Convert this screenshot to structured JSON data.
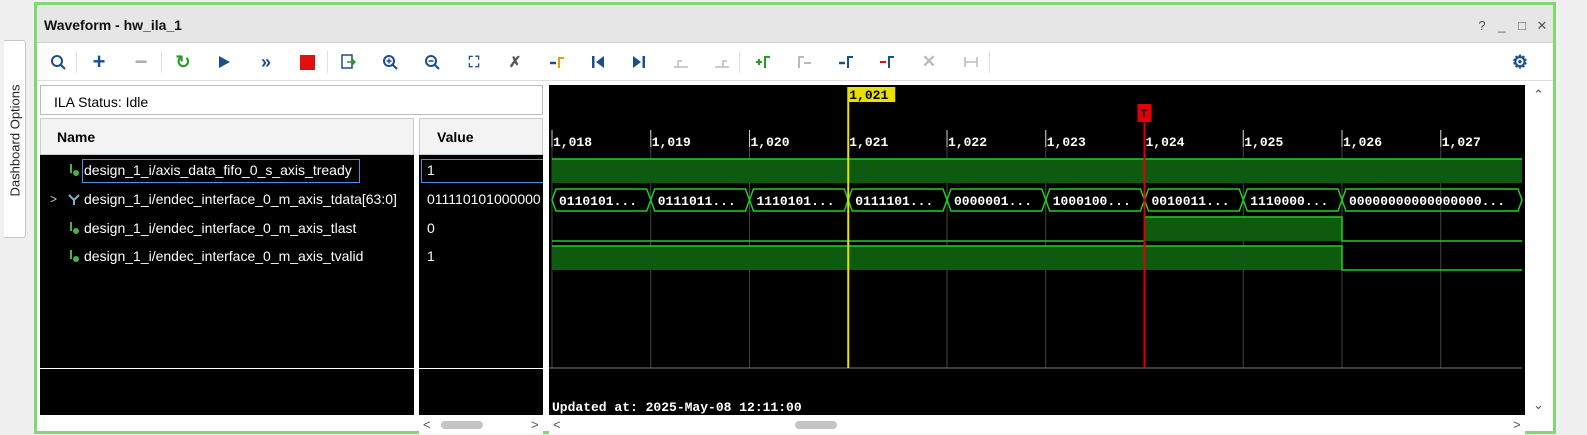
{
  "sidebar": {
    "label": "Dashboard Options"
  },
  "window": {
    "title": "Waveform - hw_ila_1",
    "controls": [
      "?",
      "_",
      "□",
      "✕"
    ]
  },
  "toolbar": {
    "icons": [
      "search-icon",
      "add-icon",
      "remove-icon",
      "refresh-icon",
      "run-icon",
      "run-all-icon",
      "stop-icon",
      "export-icon",
      "zoom-in-icon",
      "zoom-out-icon",
      "zoom-fit-icon",
      "cursor-delete-icon",
      "goto-cursor-icon",
      "goto-first-icon",
      "goto-last-icon",
      "prev-transition-icon",
      "next-transition-icon",
      "add-marker-icon",
      "prev-marker-icon",
      "next-marker-icon",
      "remove-marker-icon",
      "delete-icon",
      "swap-icon",
      "settings-icon"
    ]
  },
  "status": {
    "text": "ILA Status: Idle"
  },
  "columns": {
    "name": "Name",
    "value": "Value"
  },
  "signals": [
    {
      "name": "design_1_i/axis_data_fifo_0_s_axis_tready",
      "value": "1",
      "bus": false
    },
    {
      "name": "design_1_i/endec_interface_0_m_axis_tdata[63:0]",
      "value": "011110101000000",
      "bus": true
    },
    {
      "name": "design_1_i/endec_interface_0_m_axis_tlast",
      "value": "0",
      "bus": false
    },
    {
      "name": "design_1_i/endec_interface_0_m_axis_tvalid",
      "value": "1",
      "bus": false
    }
  ],
  "waveform": {
    "cursor_label": "1,021",
    "trigger_label": "T",
    "ticks": [
      "1,018",
      "1,019",
      "1,020",
      "1,021",
      "1,022",
      "1,023",
      "1,024",
      "1,025",
      "1,026",
      "1,027"
    ],
    "bus_values": [
      "0110101...",
      "0111011...",
      "1110101...",
      "0111101...",
      "0000001...",
      "1000100...",
      "0010011...",
      "1110000...",
      "00000000000000000..."
    ],
    "bus_value_segments": [
      1,
      1,
      1,
      1,
      1,
      1,
      1,
      1,
      2
    ],
    "tready": [
      1,
      1,
      1,
      1,
      1,
      1,
      1,
      1,
      1,
      1
    ],
    "tlast": [
      0,
      0,
      0,
      0,
      0,
      0,
      1,
      1,
      0,
      0
    ],
    "tvalid": [
      1,
      1,
      1,
      1,
      1,
      1,
      1,
      1,
      0,
      0
    ],
    "updated": "Updated at: 2025-May-08 12:11:00"
  },
  "colors": {
    "wave_green": "#22cc22",
    "wave_fill": "#0e5a0e",
    "cursor": "#e8e000",
    "trigger": "#e00000",
    "grid": "#444444",
    "accent_border": "#7fd870"
  }
}
